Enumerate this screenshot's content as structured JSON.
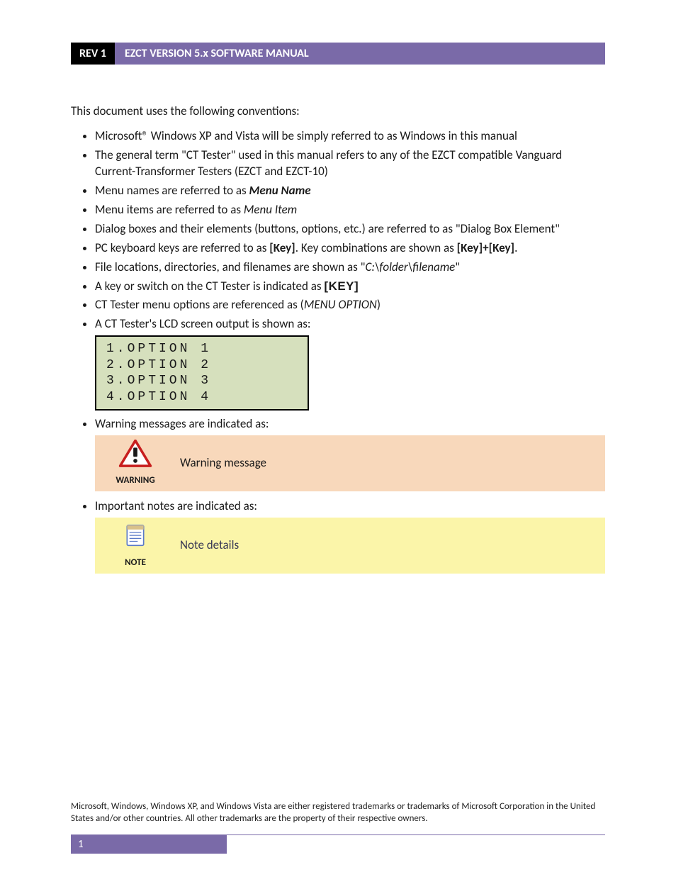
{
  "header": {
    "rev": "REV 1",
    "title": "EZCT VERSION 5.x SOFTWARE MANUAL"
  },
  "intro": "This document uses the following conventions:",
  "bullets": {
    "b1": "Microsoft® Windows XP and Vista will be simply referred to as Windows in this manual",
    "b2": "The general term \"CT Tester\" used in this manual refers to any of the EZCT compatible Vanguard Current-Transformer Testers (EZCT and EZCT-10)",
    "b3a": "Menu names are referred to as ",
    "b3b": "Menu Name",
    "b4a": "Menu items are referred to as ",
    "b4b": "Menu Item",
    "b5": "Dialog boxes and their elements (buttons, options, etc.) are referred to as \"Dialog Box Element\"",
    "b6a": "PC keyboard keys are referred to as ",
    "b6b": "[Key]",
    "b6c": ". Key combinations are shown as ",
    "b6d": "[Key]+[Key]",
    "b6e": ".",
    "b7a": "File locations, directories, and filenames are shown as \"",
    "b7b": "C:\\folder\\filename",
    "b7c": "\"",
    "b8a": "A key or switch on the CT Tester is indicated as ",
    "b8b": "[KEY]",
    "b9a": "CT Tester menu options are referenced as (",
    "b9b": "MENU OPTION",
    "b9c": ")",
    "b10": "A CT Tester's LCD screen output is shown as:",
    "b11": "Warning messages are indicated as:",
    "b12": "Important notes are indicated as:"
  },
  "lcd": {
    "l1": "1.OPTION 1",
    "l2": "2.OPTION 2",
    "l3": "3.OPTION 3",
    "l4": "4.OPTION 4"
  },
  "warning": {
    "label": "WARNING",
    "text": "Warning message"
  },
  "note": {
    "label": "NOTE",
    "text": "Note details"
  },
  "trademark": "Microsoft, Windows, Windows XP, and Windows Vista are either registered trademarks or trademarks of Microsoft Corporation in the United States and/or other countries. All other trademarks are the property of their respective owners.",
  "footer": {
    "page": "1"
  }
}
